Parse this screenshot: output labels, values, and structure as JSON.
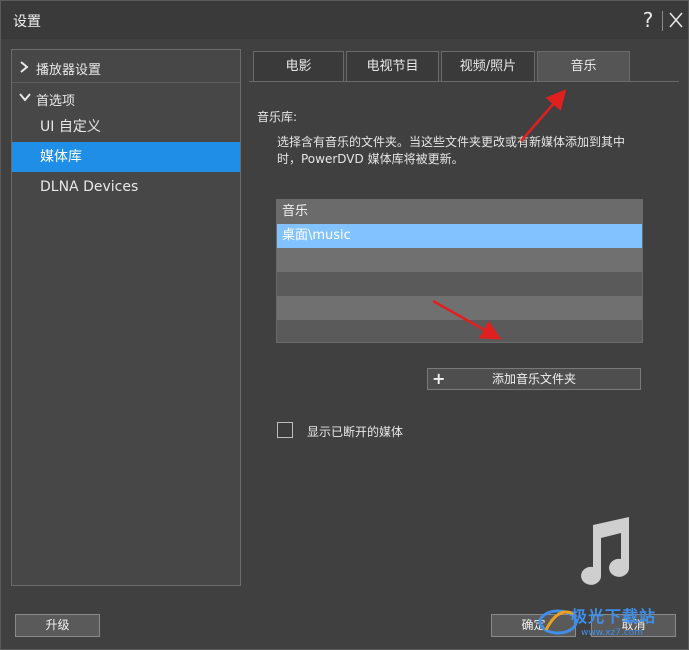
{
  "window": {
    "title": "设置",
    "help_label": "?"
  },
  "sidebar": {
    "groups": [
      {
        "label": "播放器设置",
        "expanded": false
      },
      {
        "label": "首选项",
        "expanded": true
      }
    ],
    "items": [
      {
        "label": "UI 自定义",
        "active": false
      },
      {
        "label": "媒体库",
        "active": true
      },
      {
        "label": "DLNA Devices",
        "active": false
      }
    ]
  },
  "tabs": [
    {
      "label": "电影",
      "active": false
    },
    {
      "label": "电视节目",
      "active": false
    },
    {
      "label": "视频/照片",
      "active": false
    },
    {
      "label": "音乐",
      "active": true
    }
  ],
  "library": {
    "section_title": "音乐库:",
    "description": "选择含有音乐的文件夹。当这些文件夹更改或有新媒体添加到其中时，PowerDVD 媒体库将被更新。",
    "list_header": "音乐",
    "folders": [
      "桌面\\music"
    ],
    "add_folder_label": "添加音乐文件夹",
    "show_disconnected_label": "显示已断开的媒体",
    "show_disconnected_checked": false
  },
  "footer": {
    "upgrade_label": "升级",
    "ok_label": "确定",
    "cancel_label": "取消"
  },
  "watermark": {
    "text": "极光下载站",
    "sub": "www.xz7.com"
  },
  "colors": {
    "accent": "#1e8ee6",
    "selected_row": "#82c3ff",
    "annotation_arrow": "#e02020"
  }
}
